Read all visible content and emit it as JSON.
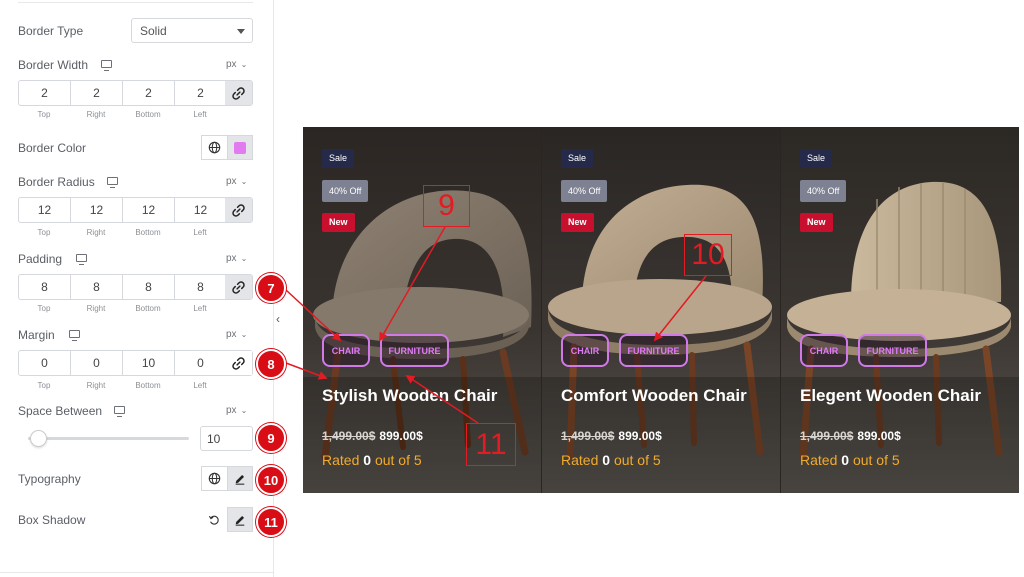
{
  "panel": {
    "border_type": {
      "label": "Border Type",
      "value": "Solid"
    },
    "border_width": {
      "label": "Border Width",
      "unit": "px",
      "values": [
        "2",
        "2",
        "2",
        "2"
      ]
    },
    "border_color": {
      "label": "Border Color",
      "swatch": "#e27bf0"
    },
    "border_radius": {
      "label": "Border Radius",
      "unit": "px",
      "values": [
        "12",
        "12",
        "12",
        "12"
      ]
    },
    "padding": {
      "label": "Padding",
      "unit": "px",
      "values": [
        "8",
        "8",
        "8",
        "8"
      ]
    },
    "margin": {
      "label": "Margin",
      "unit": "px",
      "values": [
        "0",
        "0",
        "10",
        "0"
      ]
    },
    "dim_labels": [
      "Top",
      "Right",
      "Bottom",
      "Left"
    ],
    "space_between": {
      "label": "Space Between",
      "unit": "px",
      "value": "10",
      "slider_fraction": 0.06
    },
    "typography": {
      "label": "Typography"
    },
    "box_shadow": {
      "label": "Box Shadow"
    }
  },
  "markers": [
    "7",
    "8",
    "9",
    "10",
    "11"
  ],
  "callouts": [
    "9",
    "10",
    "11"
  ],
  "cards": [
    {
      "sale": "Sale",
      "discount": "40% Off",
      "new": "New",
      "cat1": "CHAIR",
      "cat2": "FURNITURE",
      "title": "Stylish Wooden Chair",
      "old_price": "1,499.00$",
      "price": "899.00$",
      "rating_pre": "Rated",
      "rating_value": "0",
      "rating_post": "out of 5"
    },
    {
      "sale": "Sale",
      "discount": "40% Off",
      "new": "New",
      "cat1": "CHAIR",
      "cat2": "FURNITURE",
      "title": "Comfort Wooden Chair",
      "old_price": "1,499.00$",
      "price": "899.00$",
      "rating_pre": "Rated",
      "rating_value": "0",
      "rating_post": "out of 5"
    },
    {
      "sale": "Sale",
      "discount": "40% Off",
      "new": "New",
      "cat1": "CHAIR",
      "cat2": "FURNITURE",
      "title": "Elegent Wooden Chair",
      "old_price": "1,499.00$",
      "price": "899.00$",
      "rating_pre": "Rated",
      "rating_value": "0",
      "rating_post": "out of 5"
    }
  ],
  "colors": {
    "accent": "#e27bf0",
    "marker": "#d90d16",
    "rating": "#f2ab2b",
    "new_badge": "#c8102e"
  }
}
